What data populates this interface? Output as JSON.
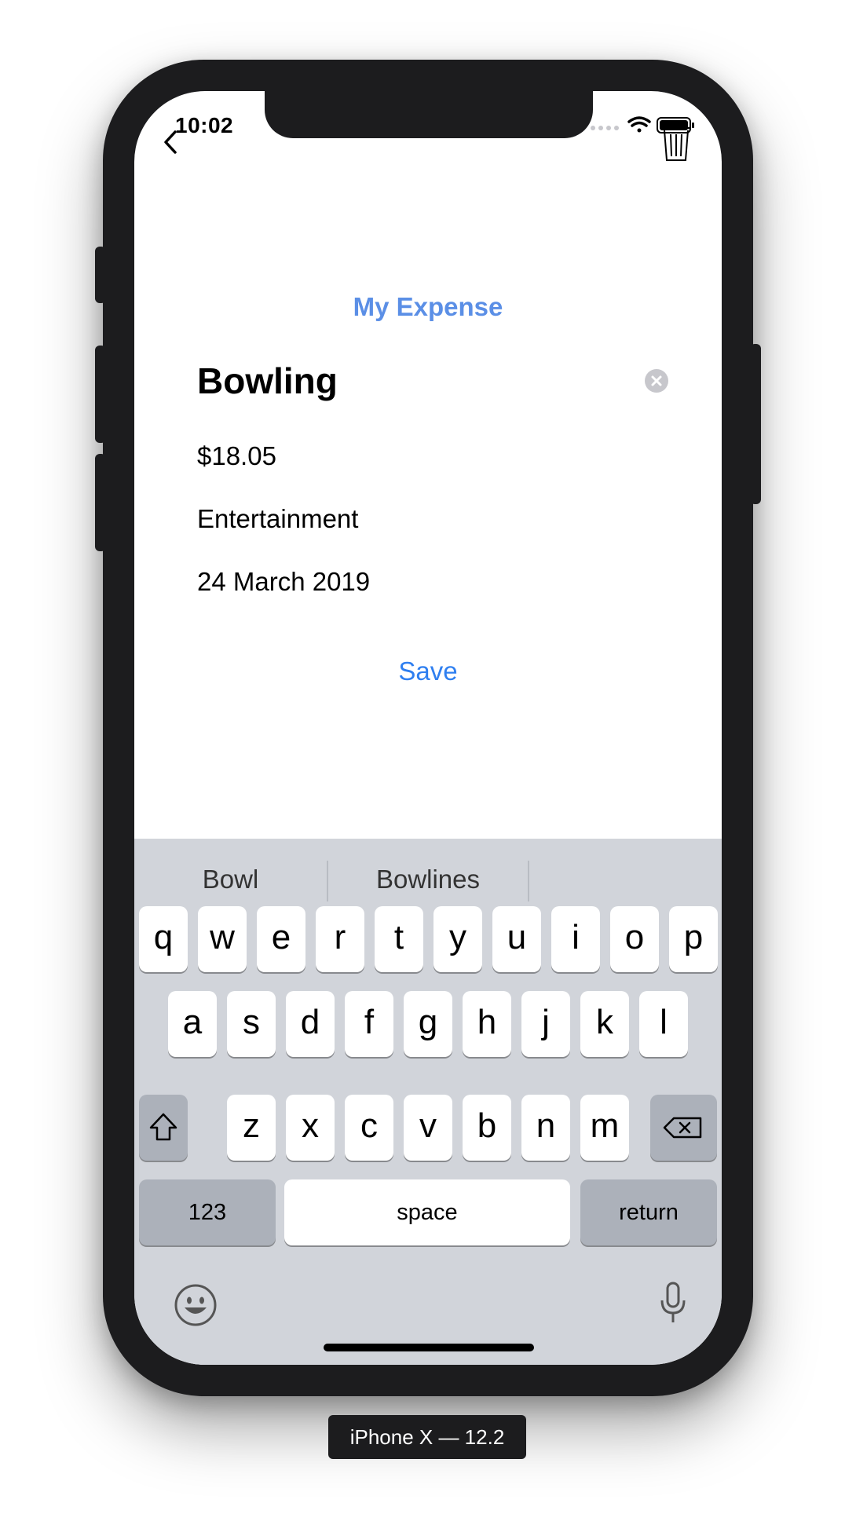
{
  "status_bar": {
    "time": "10:02"
  },
  "nav": {
    "back_icon": "chevron-left-icon",
    "delete_icon": "trash-icon"
  },
  "form": {
    "title": "My Expense",
    "name_value": "Bowling",
    "amount": "$18.05",
    "category": "Entertainment",
    "date": "24 March 2019",
    "save_label": "Save"
  },
  "keyboard": {
    "suggestions": [
      "Bowl",
      "Bowlines",
      ""
    ],
    "row1": [
      "q",
      "w",
      "e",
      "r",
      "t",
      "y",
      "u",
      "i",
      "o",
      "p"
    ],
    "row2": [
      "a",
      "s",
      "d",
      "f",
      "g",
      "h",
      "j",
      "k",
      "l"
    ],
    "row3": [
      "z",
      "x",
      "c",
      "v",
      "b",
      "n",
      "m"
    ],
    "numbers_label": "123",
    "space_label": "space",
    "return_label": "return",
    "emoji_icon": "emoji-icon",
    "mic_icon": "microphone-icon"
  },
  "device_label": "iPhone X — 12.2",
  "colors": {
    "title": "#5b8fe6",
    "save": "#2f7ff0",
    "keyboard_bg": "#d1d4da"
  }
}
